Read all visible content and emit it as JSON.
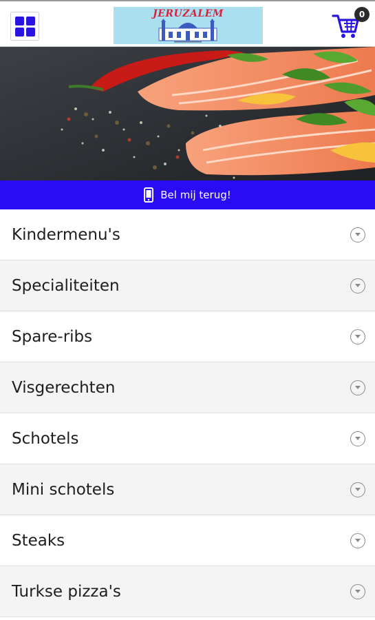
{
  "header": {
    "menu_icon": "grid-icon",
    "logo_text": "JERUZALEM",
    "cart_icon": "cart-icon",
    "cart_count": "0"
  },
  "callback": {
    "icon": "phone-icon",
    "label": "Bel mij terug!"
  },
  "categories": [
    {
      "label": "Kindermenu's"
    },
    {
      "label": "Specialiteiten"
    },
    {
      "label": "Spare-ribs"
    },
    {
      "label": "Visgerechten"
    },
    {
      "label": "Schotels"
    },
    {
      "label": "Mini schotels"
    },
    {
      "label": "Steaks"
    },
    {
      "label": "Turkse pizza's"
    }
  ],
  "colors": {
    "accent": "#2a0cf4",
    "icon_blue": "#2a14e0",
    "logo_bg": "#a9dfef",
    "logo_text": "#d6233f"
  }
}
